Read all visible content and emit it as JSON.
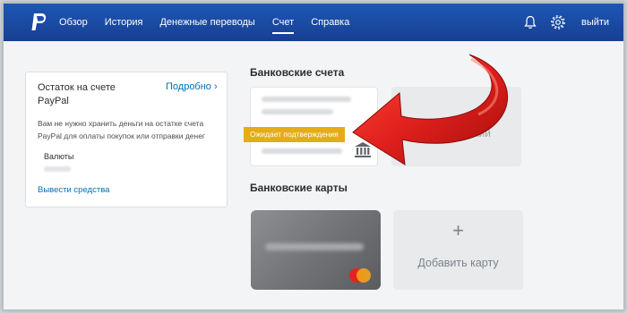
{
  "nav": {
    "items": [
      {
        "label": "Обзор"
      },
      {
        "label": "История"
      },
      {
        "label": "Денежные переводы"
      },
      {
        "label": "Счет",
        "active": true
      },
      {
        "label": "Справка"
      }
    ],
    "logout_label": "выйти"
  },
  "icons": {
    "logo": "paypal-logo-icon",
    "notifications": "bell-icon",
    "settings": "gear-icon",
    "bank": "bank-building-icon",
    "card_brand": "mastercard-logo-icon",
    "annotation": "red-curved-arrow-icon"
  },
  "balance": {
    "title": "Остаток на счете PayPal",
    "more_link": "Подробно",
    "description": "Вам не нужно хранить деньги на остатке счета PayPal для оплаты покупок или отправки денег",
    "currencies_label": "Валюты",
    "withdraw_link": "Вывести средства"
  },
  "bank_accounts": {
    "heading": "Банковские счета",
    "pending_badge": "Ожидает подтверждения",
    "link_bank_partial": "вский"
  },
  "bank_cards": {
    "heading": "Банковские карты",
    "brand": "MasterCard",
    "add_plus": "+",
    "add_label": "Добавить карту"
  },
  "colors": {
    "header": "#1b4fa8",
    "link": "#0070ba",
    "pending": "#e6ac16",
    "arrow": "#e0201c"
  }
}
